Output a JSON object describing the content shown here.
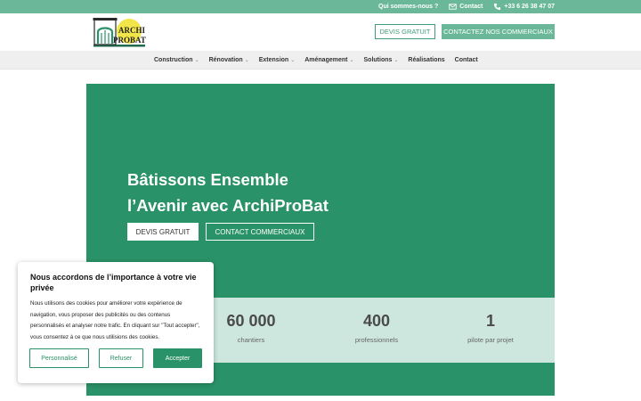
{
  "topbar": {
    "about": "Qui sommes-nous ?",
    "contact": "Contact",
    "phone": "+33 6 26 38 47 07"
  },
  "header": {
    "logo_text_1": "ARCHI",
    "logo_text_2": "PROBAT",
    "quote_button": "DEVIS GRATUIT",
    "contact_button": "CONTACTEZ NOS COMMERCIAUX"
  },
  "nav": {
    "items": [
      {
        "label": "Construction",
        "dropdown": true
      },
      {
        "label": "Rénovation",
        "dropdown": true
      },
      {
        "label": "Extension",
        "dropdown": true
      },
      {
        "label": "Aménagement",
        "dropdown": true
      },
      {
        "label": "Solutions",
        "dropdown": true
      },
      {
        "label": "Réalisations",
        "dropdown": false
      },
      {
        "label": "Contact",
        "dropdown": false
      }
    ]
  },
  "hero": {
    "title_line1": "Bâtissons Ensemble",
    "title_line2": "l’Avenir avec ArchiProBat",
    "button_quote": "DEVIS GRATUIT",
    "button_contact": "CONTACT COMMERCIAUX"
  },
  "stats": [
    {
      "value": "60 000",
      "label": "chantiers"
    },
    {
      "value": "400",
      "label": "professionnels"
    },
    {
      "value": "1",
      "label": "pilote par projet"
    }
  ],
  "cookie": {
    "title": "Nous accordons de l’importance à votre vie privée",
    "text": "Nous utilisons des cookies pour améliorer votre expérience de navigation, vous proposer des publicités ou des contenus personnalisés et analyser notre trafic. En cliquant sur \"Tout accepter\", vous consentez à ce que nous utilisions des cookies.",
    "customize": "Personnalisé",
    "reject": "Refuser",
    "accept": "Accepter"
  },
  "colors": {
    "brand_green": "#2a9268",
    "light_green": "#6ab79a",
    "stats_bg": "#cde7de",
    "logo_yellow": "#f2e54a"
  }
}
